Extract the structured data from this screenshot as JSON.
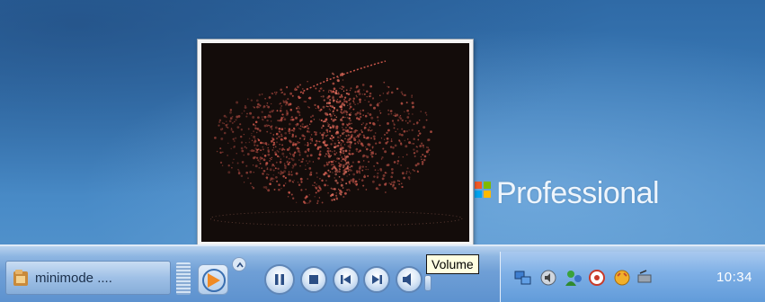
{
  "desktop": {
    "brand_text": "Professional",
    "logo_colors": [
      "#f25a26",
      "#7fba00",
      "#00a4ef",
      "#ffb900"
    ]
  },
  "video_popup": {
    "content": "video-visualization"
  },
  "taskbar": {
    "task_button": {
      "label": "minimode ....",
      "icon": "folder-icon"
    },
    "mini_player": {
      "controls": [
        "pause",
        "stop",
        "previous",
        "next",
        "mute",
        "volume"
      ],
      "tooltip": "Volume"
    },
    "tray": {
      "icons": [
        "network-icon",
        "speaker-icon",
        "user-icon",
        "shield-icon",
        "messenger-icon",
        "connection-icon"
      ],
      "clock": "10:34"
    }
  },
  "colors": {
    "desktop_blue": "#3b7bb8",
    "taskbar_blue": "#6f9fd6",
    "tooltip_bg": "#ffffe1"
  }
}
